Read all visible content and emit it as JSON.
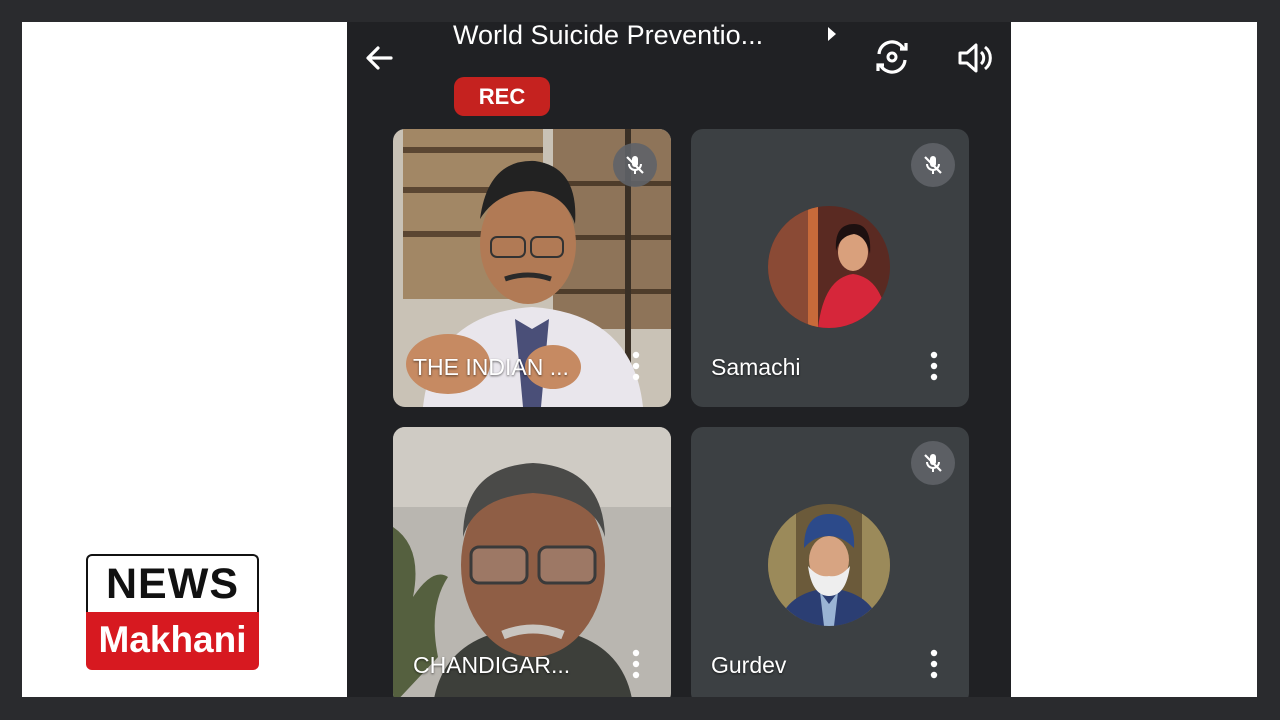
{
  "meeting": {
    "title": "World Suicide Preventio...",
    "rec_label": "REC"
  },
  "participants": [
    {
      "name": "THE INDIAN ...",
      "muted": true,
      "video": true
    },
    {
      "name": "Samachi",
      "muted": true,
      "video": false
    },
    {
      "name": "CHANDIGAR...",
      "muted": false,
      "video": true
    },
    {
      "name": "Gurdev",
      "muted": true,
      "video": false
    }
  ],
  "icons": [
    "back-arrow-icon",
    "chevron-right-icon",
    "switch-camera-icon",
    "speaker-icon",
    "mic-off-icon",
    "more-vert-icon"
  ],
  "branding": {
    "line1": "NEWS",
    "line2": "Makhani"
  },
  "colors": {
    "rec": "#c5221f",
    "tile": "#3c4043",
    "app_bg": "#202124",
    "brand_red": "#d71920"
  }
}
